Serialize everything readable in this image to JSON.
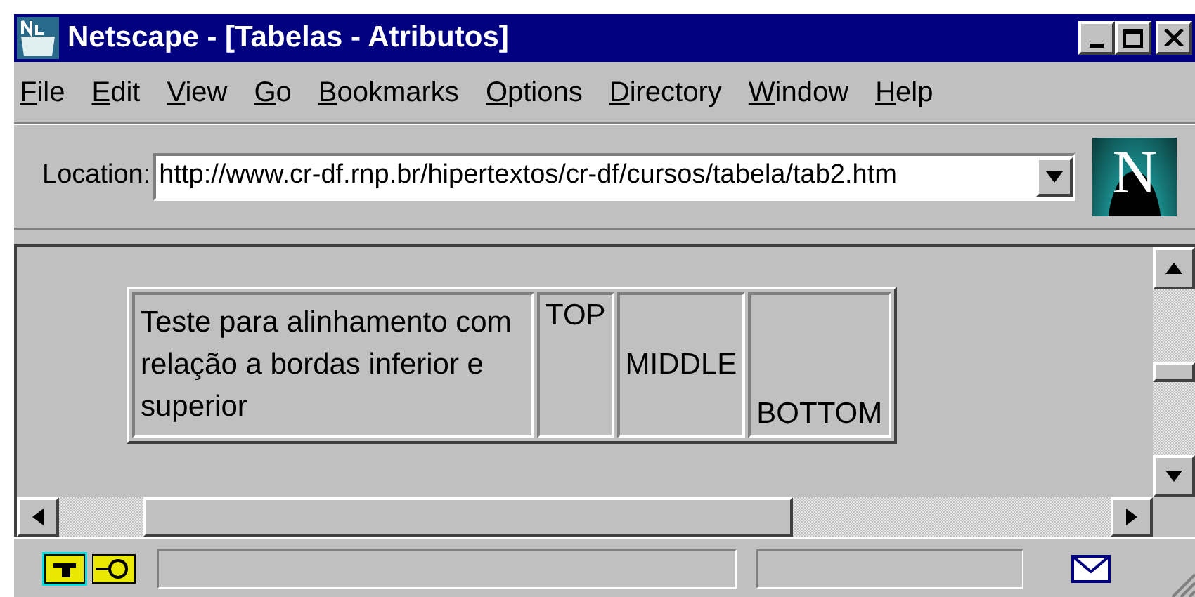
{
  "window": {
    "title": "Netscape - [Tabelas - Atributos]"
  },
  "menu": [
    "File",
    "Edit",
    "View",
    "Go",
    "Bookmarks",
    "Options",
    "Directory",
    "Window",
    "Help"
  ],
  "location": {
    "label": "Location:",
    "value": "http://www.cr-df.rnp.br/hipertextos/cr-df/cursos/tabela/tab2.htm"
  },
  "logo": {
    "letter": "N"
  },
  "table": {
    "cells": [
      {
        "text": "Teste para alinhamento com relação a bordas inferior e superior",
        "kind": "middle"
      },
      {
        "text": "TOP",
        "kind": "top"
      },
      {
        "text": "MIDDLE",
        "kind": "middle"
      },
      {
        "text": "BOTTOM",
        "kind": "bottom"
      }
    ]
  }
}
